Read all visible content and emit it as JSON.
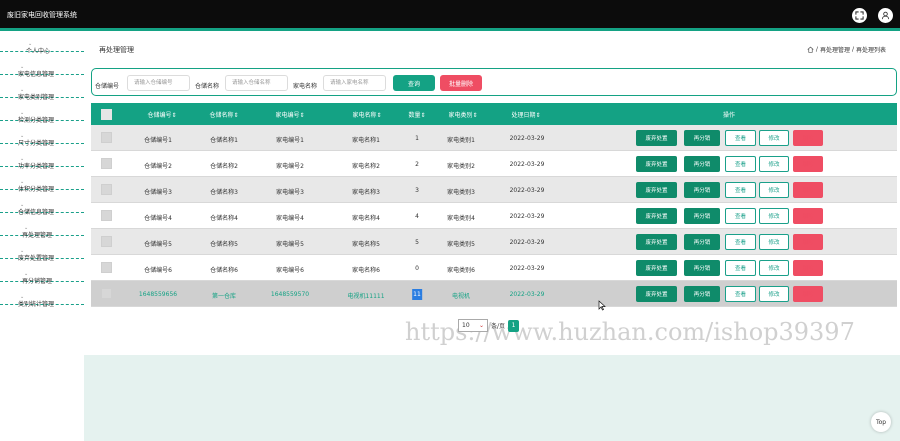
{
  "app": {
    "title": "废旧家电回收管理系统"
  },
  "header_icons": [
    "fullscreen-icon",
    "user-icon"
  ],
  "colors": {
    "accent": "#14a284",
    "danger": "#ef4d63",
    "primary_btn": "#0f8b6a",
    "topbar": "#0c0c0c"
  },
  "sidebar": {
    "items": [
      {
        "label": "个人中心"
      },
      {
        "label": "家电信息管理"
      },
      {
        "label": "家电类别管理"
      },
      {
        "label": "检测分类管理"
      },
      {
        "label": "尺寸分类管理"
      },
      {
        "label": "功率分类管理"
      },
      {
        "label": "体积分类管理"
      },
      {
        "label": "仓储信息管理"
      },
      {
        "label": "再处理管理"
      },
      {
        "label": "废弃处置管理"
      },
      {
        "label": "再分销管理"
      },
      {
        "label": "类别统计管理"
      }
    ]
  },
  "page": {
    "title": "再处理管理",
    "breadcrumb": [
      "再处理管理",
      "再处理列表"
    ],
    "breadcrumb_sep": "/"
  },
  "search": {
    "field1_label": "仓储编号",
    "field1_placeholder": "请输入仓储编号",
    "field2_label": "仓储名称",
    "field2_placeholder": "请输入仓储名称",
    "field3_label": "家电名称",
    "field3_placeholder": "请输入家电名称",
    "query_label": "查询",
    "batch_delete_label": "批量删除"
  },
  "table": {
    "columns": [
      "仓储编号",
      "仓储名称",
      "家电编号",
      "家电名称",
      "数量",
      "家电类别",
      "处理日期",
      "操作"
    ],
    "sort_marker": "⇕",
    "actions": {
      "discard": "废弃处置",
      "redistribute": "再分销",
      "view": "查看",
      "edit": "修改",
      "delete": "删除"
    },
    "rows": [
      {
        "c1": "仓储编号1",
        "c2": "仓储名称1",
        "c3": "家电编号1",
        "c4": "家电名称1",
        "c5": "1",
        "c6": "家电类别1",
        "c7": "2022-03-29"
      },
      {
        "c1": "仓储编号2",
        "c2": "仓储名称2",
        "c3": "家电编号2",
        "c4": "家电名称2",
        "c5": "2",
        "c6": "家电类别2",
        "c7": "2022-03-29"
      },
      {
        "c1": "仓储编号3",
        "c2": "仓储名称3",
        "c3": "家电编号3",
        "c4": "家电名称3",
        "c5": "3",
        "c6": "家电类别3",
        "c7": "2022-03-29"
      },
      {
        "c1": "仓储编号4",
        "c2": "仓储名称4",
        "c3": "家电编号4",
        "c4": "家电名称4",
        "c5": "4",
        "c6": "家电类别4",
        "c7": "2022-03-29"
      },
      {
        "c1": "仓储编号5",
        "c2": "仓储名称5",
        "c3": "家电编号5",
        "c4": "家电名称5",
        "c5": "5",
        "c6": "家电类别5",
        "c7": "2022-03-29"
      },
      {
        "c1": "仓储编号6",
        "c2": "仓储名称6",
        "c3": "家电编号6",
        "c4": "家电名称6",
        "c5": "0",
        "c6": "家电类别6",
        "c7": "2022-03-29"
      },
      {
        "c1": "1648559656",
        "c2": "第一仓库",
        "c3": "1648559570",
        "c4": "电视机11111",
        "c5": "11",
        "c6": "电视机",
        "c7": "2022-03-29"
      }
    ]
  },
  "pager": {
    "page_size": "10",
    "page_size_suffix": "条/页",
    "current_page": "1"
  },
  "scroll_top_label": "Top",
  "watermark": "https://www.huzhan.com/ishop39397"
}
